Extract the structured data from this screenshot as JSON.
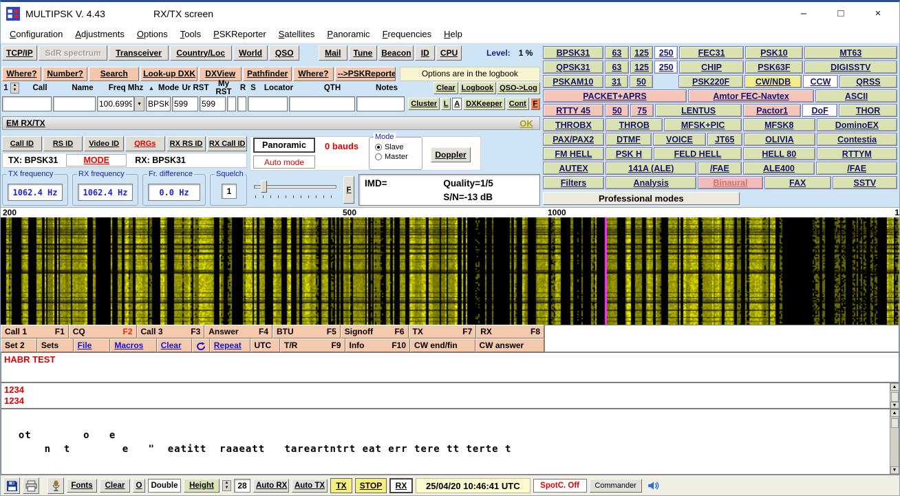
{
  "titlebar": {
    "app_title": "MULTIPSK V. 4.43",
    "screen_title": "RX/TX screen",
    "minimize": "–",
    "maximize": "□",
    "close": "×"
  },
  "menu": [
    "Configuration",
    "Adjustments",
    "Options",
    "Tools",
    "PSKReporter",
    "Satellites",
    "Panoramic",
    "Frequencies",
    "Help"
  ],
  "toolbar": {
    "left": [
      {
        "t": "TCP/IP",
        "f": 48
      },
      {
        "t": "SdR spectrum",
        "f": 104,
        "v": "disabled"
      },
      {
        "t": "Transceiver",
        "f": 88
      },
      {
        "t": "Country/Loc",
        "f": 92
      },
      {
        "t": "World",
        "f": 48
      },
      {
        "t": "QSO",
        "f": 40
      }
    ],
    "right": [
      {
        "t": "Mail",
        "f": 42
      },
      {
        "t": "Tune",
        "f": 42
      },
      {
        "t": "Beacon",
        "f": 54
      },
      {
        "t": "ID",
        "f": 26
      },
      {
        "t": "CPU",
        "f": 36
      }
    ],
    "level_label": "Level:",
    "level_value": "1 %"
  },
  "lookup": {
    "buttons": [
      {
        "t": "Where?",
        "f": 56
      },
      {
        "t": "Number?",
        "f": 66
      },
      {
        "t": "Search",
        "f": 74
      },
      {
        "t": "Look-up DXK",
        "f": 86
      },
      {
        "t": "DXView",
        "f": 62
      },
      {
        "t": "Pathfinder",
        "f": 72
      },
      {
        "t": "Where?",
        "f": 58
      },
      {
        "t": "-->PSKReporter",
        "f": 92
      }
    ],
    "note": "Options are in the logbook"
  },
  "logbook": {
    "row_number": "1",
    "headers": [
      "Call",
      "Name",
      "Freq Mhz",
      "Mode",
      "Ur RST",
      "My RST",
      "R",
      "S",
      "Locator",
      "QTH",
      "Notes"
    ],
    "fields": {
      "call": "",
      "name": "",
      "freq": "100.6999",
      "mode": "BPSK",
      "ur_rst": "599",
      "my_rst": "599",
      "r": "",
      "s": "",
      "locator": "",
      "qth": "",
      "notes": ""
    },
    "clear": "Clear",
    "logbook_btn": "Logbook",
    "qso_to_log": "QSO->Log",
    "cluster": "Cluster",
    "l": "L",
    "a": "A",
    "dxkeeper": "DXKeeper",
    "cont": "Cont",
    "f": "F"
  },
  "em_bar": {
    "title": "EM RX/TX",
    "ok": "OK"
  },
  "id_row": {
    "buttons": [
      {
        "t": "Call ID"
      },
      {
        "t": "RS ID"
      },
      {
        "t": "Video ID"
      },
      {
        "t": "QRGs",
        "v": "red"
      },
      {
        "t": "RX RS ID"
      },
      {
        "t": "RX Call ID"
      }
    ],
    "panoramic": "Panoramic",
    "bauds": "0 bauds",
    "mode_group": {
      "label": "Mode",
      "options": [
        {
          "t": "Slave",
          "selected": true
        },
        {
          "t": "Master",
          "selected": false
        }
      ]
    },
    "doppler": "Doppler"
  },
  "mode_row": {
    "tx": "TX: BPSK31",
    "mode_btn": "MODE",
    "rx": "RX: BPSK31",
    "auto": "Auto mode"
  },
  "freq_panel": {
    "tx": {
      "label": "TX frequency",
      "value": "1062.4 Hz"
    },
    "rx": {
      "label": "RX frequency",
      "value": "1062.4 Hz"
    },
    "diff": {
      "label": "Fr. difference",
      "value": "0.0 Hz"
    },
    "squelch": {
      "label": "Squelch",
      "value": "1"
    },
    "f_btn": "F",
    "imd": "IMD=",
    "quality": "Quality=1/5",
    "snr": "S/N=-13 dB"
  },
  "modes_panel": {
    "rows": [
      [
        {
          "t": "BPSK31",
          "f": 90
        },
        {
          "t": "63",
          "f": 34
        },
        {
          "t": "125",
          "f": 33
        },
        {
          "t": "250",
          "f": 33,
          "v": "w"
        },
        {
          "t": "FEC31",
          "f": 96
        },
        {
          "t": "PSK10",
          "f": 85
        },
        {
          "t": "MT63",
          "f": 139
        }
      ],
      [
        {
          "t": "QPSK31",
          "f": 90
        },
        {
          "t": "63",
          "f": 34
        },
        {
          "t": "125",
          "f": 33
        },
        {
          "t": "250",
          "f": 33,
          "v": "w"
        },
        {
          "t": "CHIP",
          "f": 96
        },
        {
          "t": "PSK63F",
          "f": 85
        },
        {
          "t": "DIGISSTV",
          "f": 139
        }
      ],
      [
        {
          "t": "PSKAM10",
          "f": 90
        },
        {
          "t": "31",
          "f": 34
        },
        {
          "t": "50",
          "f": 33
        },
        {
          "t": "",
          "f": 33,
          "v": "ghost"
        },
        {
          "t": "PSK220F",
          "f": 96
        },
        {
          "t": "CW/NDB",
          "f": 85,
          "v": "y"
        },
        {
          "t": "CCW",
          "f": 51,
          "v": "w"
        },
        {
          "t": "QRSS",
          "f": 86
        }
      ],
      [
        {
          "t": "PACKET+APRS",
          "f": 211,
          "v": "p"
        },
        {
          "t": "Amtor FEC-Navtex",
          "f": 184,
          "v": "p"
        },
        {
          "t": "ASCII",
          "f": 119
        }
      ],
      [
        {
          "t": "RTTY 45",
          "f": 90,
          "v": "p"
        },
        {
          "t": "50",
          "f": 34,
          "v": "p"
        },
        {
          "t": "75",
          "f": 33,
          "v": "p"
        },
        {
          "t": "LENTUS",
          "f": 129
        },
        {
          "t": "Pactor1",
          "f": 85,
          "v": "p"
        },
        {
          "t": "DoF",
          "f": 51,
          "v": "w"
        },
        {
          "t": "THOR",
          "f": 86
        }
      ],
      [
        {
          "t": "THROBX",
          "f": 90
        },
        {
          "t": "THROB",
          "f": 84
        },
        {
          "t": "MFSK+PIC",
          "f": 114
        },
        {
          "t": "MFSK8",
          "f": 106
        },
        {
          "t": "DominoEX",
          "f": 119
        }
      ],
      [
        {
          "t": "PAX/PAX2",
          "f": 90
        },
        {
          "t": "DTMF",
          "f": 68
        },
        {
          "t": "VOICE",
          "f": 77
        },
        {
          "t": "JT65",
          "f": 51
        },
        {
          "t": "OLIVIA",
          "f": 106
        },
        {
          "t": "Contestia",
          "f": 119
        }
      ],
      [
        {
          "t": "FM HELL",
          "f": 90
        },
        {
          "t": "PSK H",
          "f": 68
        },
        {
          "t": "FELD HELL",
          "f": 130
        },
        {
          "t": "HELL 80",
          "f": 106
        },
        {
          "t": "RTTYM",
          "f": 119
        }
      ],
      [
        {
          "t": "AUTEX",
          "f": 90
        },
        {
          "t": "141A (ALE)",
          "f": 134
        },
        {
          "t": "/FAE",
          "f": 63
        },
        {
          "t": "ALE400",
          "f": 106
        },
        {
          "t": "/FAE",
          "f": 119
        }
      ],
      [
        {
          "t": "Filters",
          "f": 90
        },
        {
          "t": "Analysis",
          "f": 134
        },
        {
          "t": "Binaural",
          "f": 95,
          "v": "d"
        },
        {
          "t": "FAX",
          "f": 98
        },
        {
          "t": "SSTV",
          "f": 95
        }
      ]
    ],
    "professional": "Professional modes"
  },
  "scale": {
    "labels": [
      "200",
      "500",
      "1000",
      "1"
    ]
  },
  "macros": {
    "row1": [
      {
        "t": "Call 1",
        "k": "F1"
      },
      {
        "t": "CQ",
        "k": "F2",
        "v": "hot"
      },
      {
        "t": "Call 3",
        "k": "F3"
      },
      {
        "t": "Answer",
        "k": "F4"
      },
      {
        "t": "BTU",
        "k": "F5"
      },
      {
        "t": "Signoff",
        "k": "F6"
      },
      {
        "t": "TX",
        "k": "F7"
      },
      {
        "t": "RX",
        "k": "F8"
      }
    ],
    "row2a": [
      {
        "t": "Set 2",
        "f": 48
      },
      {
        "t": "Sets",
        "f": 48
      },
      {
        "t": "File",
        "f": 49,
        "v": "link"
      },
      {
        "t": "Macros",
        "f": 65,
        "v": "link"
      },
      {
        "t": "Clear",
        "f": 46,
        "v": "link"
      }
    ],
    "row2c": [
      {
        "t": "Repeat",
        "f": 55,
        "v": "link"
      },
      {
        "t": "UTC",
        "f": 37
      }
    ],
    "row2b": [
      {
        "t": "T/R",
        "k": "F9",
        "f": 97
      },
      {
        "t": "Info",
        "k": "F10",
        "f": 97
      },
      {
        "t": "CW end/fin",
        "f": 97
      },
      {
        "t": "CW answer",
        "f": 104
      }
    ]
  },
  "tx_text1": "HABR TEST",
  "tx_text2": "1234\n1234",
  "rx_text": "  ot        o   e\n      n  t        e   \"  eatitt  raaeatt   tareartntrt eat err tere tt terte t",
  "statusbar": {
    "fonts": "Fonts",
    "clear": "Clear",
    "o": "O",
    "double": "Double",
    "height": "Height",
    "height_value": "28",
    "auto_rx": "Auto RX",
    "auto_tx": "Auto TX",
    "tx": "TX",
    "stop": "STOP",
    "rx": "RX",
    "datetime": "25/04/20 10:46:41 UTC",
    "spotc": "SpotC. Off",
    "commander": "Commander"
  }
}
